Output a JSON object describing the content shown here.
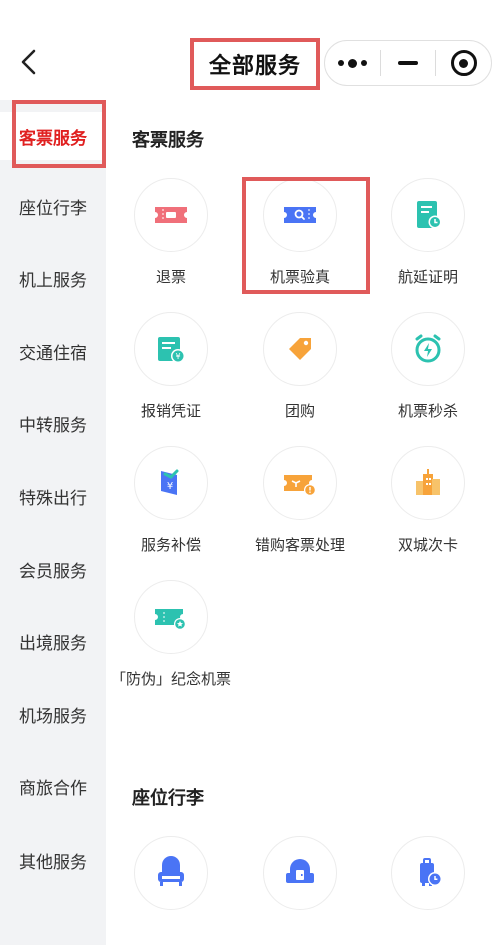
{
  "header": {
    "title": "全部服务"
  },
  "sidebar": {
    "items": [
      {
        "label": "客票服务",
        "active": true
      },
      {
        "label": "座位行李"
      },
      {
        "label": "机上服务"
      },
      {
        "label": "交通住宿"
      },
      {
        "label": "中转服务"
      },
      {
        "label": "特殊出行"
      },
      {
        "label": "会员服务"
      },
      {
        "label": "出境服务"
      },
      {
        "label": "机场服务"
      },
      {
        "label": "商旅合作"
      },
      {
        "label": "其他服务"
      }
    ]
  },
  "sections": [
    {
      "title": "客票服务",
      "services": [
        {
          "label": "退票",
          "icon": "refund-ticket-icon"
        },
        {
          "label": "机票验真",
          "icon": "ticket-verify-icon"
        },
        {
          "label": "航延证明",
          "icon": "delay-certificate-icon"
        },
        {
          "label": "报销凭证",
          "icon": "reimbursement-icon"
        },
        {
          "label": "团购",
          "icon": "group-buy-tag-icon"
        },
        {
          "label": "机票秒杀",
          "icon": "flash-sale-clock-icon"
        },
        {
          "label": "服务补偿",
          "icon": "compensation-icon"
        },
        {
          "label": "错购客票处理",
          "icon": "wrong-ticket-icon"
        },
        {
          "label": "双城次卡",
          "icon": "dual-city-card-icon"
        },
        {
          "label": "「防伪」纪念机票",
          "icon": "souvenir-ticket-icon"
        }
      ]
    },
    {
      "title": "座位行李",
      "services": [
        {
          "label": "",
          "icon": "seat-icon"
        },
        {
          "label": "",
          "icon": "cabin-door-icon"
        },
        {
          "label": "",
          "icon": "luggage-clock-icon"
        }
      ]
    }
  ],
  "colors": {
    "active": "#e02020",
    "highlight": "#e05a5a",
    "sidebar_bg": "#f2f3f5",
    "icon_red": "#f0707a",
    "icon_blue": "#4a74f5",
    "icon_teal": "#2cc2b0",
    "icon_orange": "#f7a33a"
  }
}
